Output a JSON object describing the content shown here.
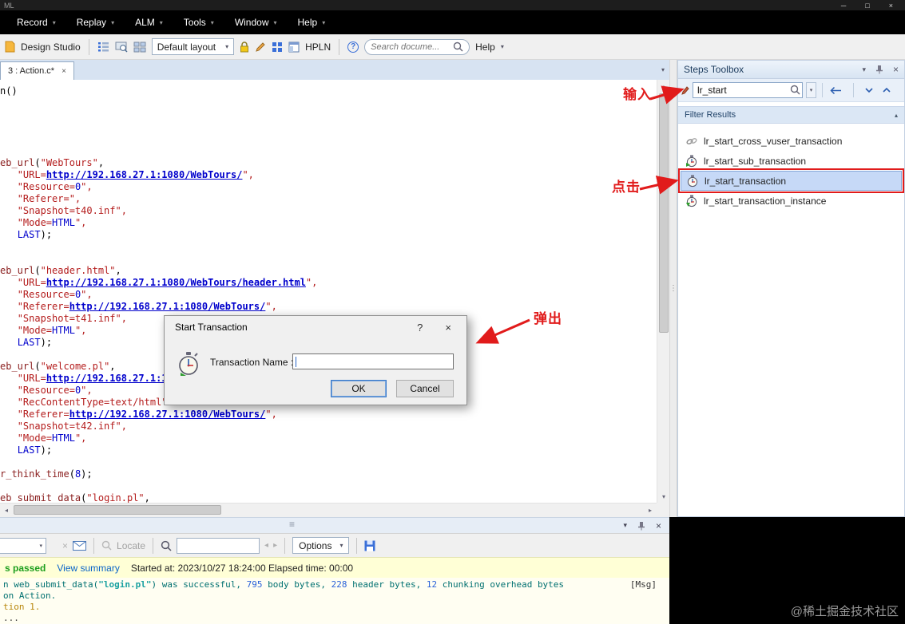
{
  "window": {
    "title": "ML"
  },
  "icons": {
    "dropdown": "▾",
    "chevron_up": "▴",
    "minimize": "─",
    "maximize": "□",
    "close": "×",
    "grip_h": "≡",
    "grip_v": "⋮",
    "scroll_left": "◂",
    "scroll_right": "▸",
    "scroll_up": "▴",
    "scroll_down": "▾",
    "question": "?"
  },
  "menubar": {
    "items": [
      "Record",
      "Replay",
      "ALM",
      "Tools",
      "Window",
      "Help"
    ]
  },
  "toolbar": {
    "design_studio_label": "Design Studio",
    "layout_combo_value": "Default layout",
    "hpln_label": "HPLN",
    "search_placeholder": "Search docume...",
    "help_label": "Help"
  },
  "editor": {
    "tab_label": "3 : Action.c*",
    "code_lines": [
      [
        [
          "pl",
          "n()"
        ]
      ],
      [],
      [],
      [],
      [],
      [],
      [
        [
          "fn",
          "eb_url"
        ],
        [
          "pl",
          "("
        ],
        [
          "st",
          "\"WebTours\""
        ],
        [
          "pl",
          ","
        ]
      ],
      [
        [
          "pl",
          "   "
        ],
        [
          "st",
          "\"URL="
        ],
        [
          "ur",
          "http://192.168.27.1:1080/WebTours/"
        ],
        [
          "st",
          "\","
        ]
      ],
      [
        [
          "pl",
          "   "
        ],
        [
          "st",
          "\"Resource="
        ],
        [
          "nu",
          "0"
        ],
        [
          "st",
          "\","
        ]
      ],
      [
        [
          "pl",
          "   "
        ],
        [
          "st",
          "\"Referer=\","
        ]
      ],
      [
        [
          "pl",
          "   "
        ],
        [
          "st",
          "\"Snapshot=t40.inf\","
        ]
      ],
      [
        [
          "pl",
          "   "
        ],
        [
          "st",
          "\"Mode="
        ],
        [
          "kw",
          "HTML"
        ],
        [
          "st",
          "\","
        ]
      ],
      [
        [
          "pl",
          "   "
        ],
        [
          "kw",
          "LAST"
        ],
        [
          "pl",
          ");"
        ]
      ],
      [],
      [],
      [
        [
          "fn",
          "eb_url"
        ],
        [
          "pl",
          "("
        ],
        [
          "st",
          "\"header.html\""
        ],
        [
          "pl",
          ","
        ]
      ],
      [
        [
          "pl",
          "   "
        ],
        [
          "st",
          "\"URL="
        ],
        [
          "ur",
          "http://192.168.27.1:1080/WebTours/header.html"
        ],
        [
          "st",
          "\","
        ]
      ],
      [
        [
          "pl",
          "   "
        ],
        [
          "st",
          "\"Resource="
        ],
        [
          "nu",
          "0"
        ],
        [
          "st",
          "\","
        ]
      ],
      [
        [
          "pl",
          "   "
        ],
        [
          "st",
          "\"Referer="
        ],
        [
          "ur",
          "http://192.168.27.1:1080/WebTours/"
        ],
        [
          "st",
          "\","
        ]
      ],
      [
        [
          "pl",
          "   "
        ],
        [
          "st",
          "\"Snapshot=t41.inf\","
        ]
      ],
      [
        [
          "pl",
          "   "
        ],
        [
          "st",
          "\"Mode="
        ],
        [
          "kw",
          "HTML"
        ],
        [
          "st",
          "\","
        ]
      ],
      [
        [
          "pl",
          "   "
        ],
        [
          "kw",
          "LAST"
        ],
        [
          "pl",
          ");"
        ]
      ],
      [],
      [
        [
          "fn",
          "eb_url"
        ],
        [
          "pl",
          "("
        ],
        [
          "st",
          "\"welcome.pl\""
        ],
        [
          "pl",
          ","
        ]
      ],
      [
        [
          "pl",
          "   "
        ],
        [
          "st",
          "\"URL="
        ],
        [
          "ur",
          "http://192.168.27.1:1"
        ]
      ],
      [
        [
          "pl",
          "   "
        ],
        [
          "st",
          "\"Resource="
        ],
        [
          "nu",
          "0"
        ],
        [
          "st",
          "\","
        ]
      ],
      [
        [
          "pl",
          "   "
        ],
        [
          "st",
          "\"RecContentType=text/html\""
        ]
      ],
      [
        [
          "pl",
          "   "
        ],
        [
          "st",
          "\"Referer="
        ],
        [
          "ur",
          "http://192.168.27.1:1080/WebTours/"
        ],
        [
          "st",
          "\","
        ]
      ],
      [
        [
          "pl",
          "   "
        ],
        [
          "st",
          "\"Snapshot=t42.inf\","
        ]
      ],
      [
        [
          "pl",
          "   "
        ],
        [
          "st",
          "\"Mode="
        ],
        [
          "kw",
          "HTML"
        ],
        [
          "st",
          "\","
        ]
      ],
      [
        [
          "pl",
          "   "
        ],
        [
          "kw",
          "LAST"
        ],
        [
          "pl",
          ");"
        ]
      ],
      [],
      [
        [
          "fn",
          "r_think_time"
        ],
        [
          "pl",
          "("
        ],
        [
          "nu",
          "8"
        ],
        [
          "pl",
          ");"
        ]
      ],
      [],
      [
        [
          "fn",
          "eb_submit_data"
        ],
        [
          "pl",
          "("
        ],
        [
          "st",
          "\"login.pl\""
        ],
        [
          "pl",
          ","
        ]
      ]
    ]
  },
  "steps_toolbox": {
    "title": "Steps Toolbox",
    "search_value": "lr_start",
    "filter_header": "Filter Results",
    "items": [
      {
        "label": "lr_start_cross_vuser_transaction",
        "icon": "link-icon",
        "selected": false
      },
      {
        "label": "lr_start_sub_transaction",
        "icon": "stopwatch-add-icon",
        "selected": false
      },
      {
        "label": "lr_start_transaction",
        "icon": "stopwatch-icon",
        "selected": true
      },
      {
        "label": "lr_start_transaction_instance",
        "icon": "stopwatch-instance-icon",
        "selected": false
      }
    ]
  },
  "dialog": {
    "title": "Start Transaction",
    "field_label": "Transaction Name :",
    "ok_label": "OK",
    "cancel_label": "Cancel"
  },
  "annotations": {
    "input_label": "输入",
    "click_label": "点击",
    "popup_label": "弹出"
  },
  "bottom_panel": {
    "locate_label": "Locate",
    "options_label": "Options",
    "status": {
      "passed_text": "s passed",
      "view_summary": "View summary",
      "started_text": "Started at: 2023/10/27 18:24:00 Elapsed time: 00:00"
    },
    "log_lines": [
      {
        "segments": [
          [
            "t",
            "n web_submit_data("
          ],
          [
            "hl",
            "\"login.pl\""
          ],
          [
            "t",
            ") was successful, "
          ],
          [
            "n",
            "795"
          ],
          [
            "t",
            " body bytes, "
          ],
          [
            "n",
            "228"
          ],
          [
            "t",
            " header bytes, "
          ],
          [
            "n",
            "12"
          ],
          [
            "t",
            " chunking overhead bytes"
          ]
        ],
        "tag": "[Msg]"
      },
      {
        "segments": [
          [
            "t",
            "on Action."
          ]
        ]
      },
      {
        "segments": [
          [
            "o",
            "tion 1."
          ]
        ]
      },
      {
        "segments": [
          [
            "d",
            "..."
          ]
        ]
      }
    ]
  },
  "watermark": "@稀土掘金技术社区",
  "colors": {
    "annotation_red": "#e11b1b",
    "url_blue": "#0000cc",
    "string_red": "#b41c1c",
    "log_teal": "#007070",
    "selection_blue": "#c6d9f7"
  }
}
